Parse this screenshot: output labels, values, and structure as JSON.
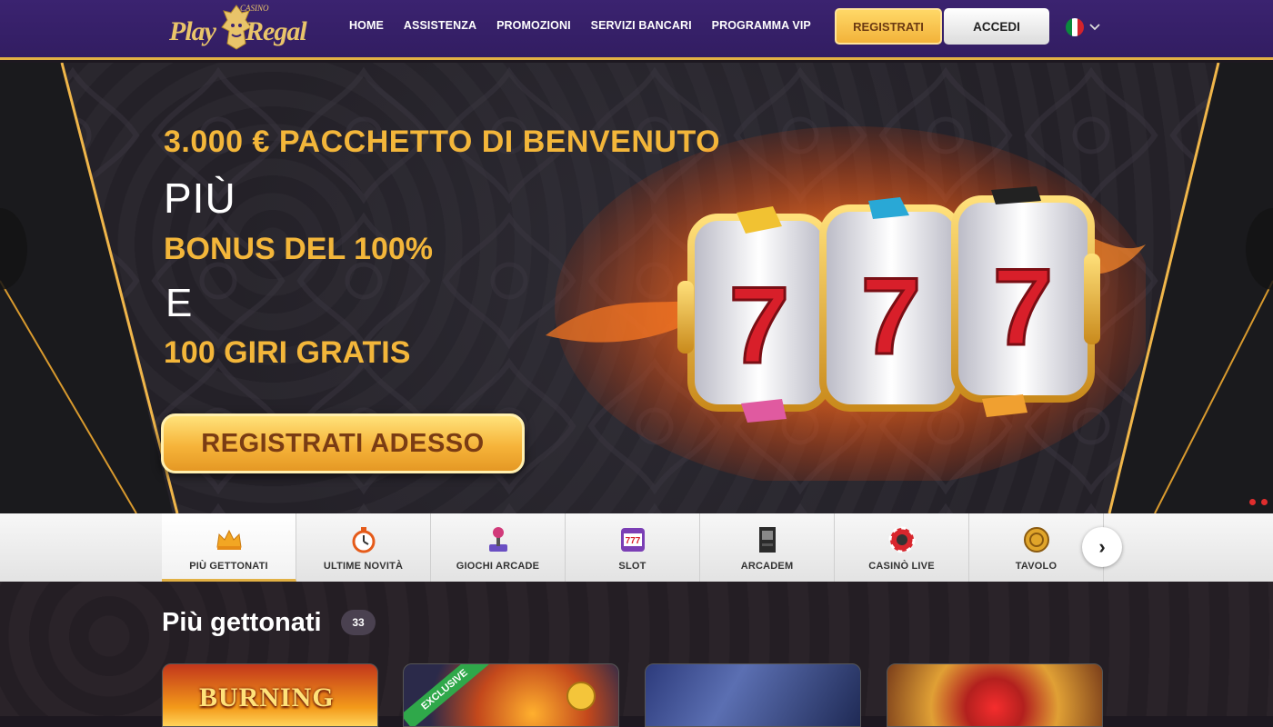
{
  "header": {
    "logo": {
      "casino": "CASINO",
      "play": "Play",
      "regal": "Regal"
    },
    "nav": [
      {
        "label": "HOME"
      },
      {
        "label": "ASSISTENZA"
      },
      {
        "label": "PROMOZIONI"
      },
      {
        "label": "SERVIZI BANCARI"
      },
      {
        "label": "PROGRAMMA VIP"
      }
    ],
    "register_label": "REGISTRATI",
    "login_label": "ACCEDI",
    "language_icon": "italy-flag-icon",
    "language_chevron": "chevron-down-icon"
  },
  "hero": {
    "line1": "3.000 € PACCHETTO DI BENVENUTO",
    "line2": "PIÙ",
    "line3": "BONUS DEL 100%",
    "line4": "E",
    "line5": "100 GIRI GRATIS",
    "cta_label": "REGISTRATI ADESSO",
    "colors": {
      "accent": "#f3b63a",
      "white": "#ffffff"
    }
  },
  "categories": [
    {
      "label": "PIÙ GETTONATI",
      "icon": "crown-icon",
      "active": true
    },
    {
      "label": "ULTIME NOVITÀ",
      "icon": "stopwatch-icon",
      "active": false
    },
    {
      "label": "GIOCHI ARCADE",
      "icon": "joystick-icon",
      "active": false
    },
    {
      "label": "SLOT",
      "icon": "slot-machine-icon",
      "active": false
    },
    {
      "label": "ARCADEM",
      "icon": "arcade-cabinet-icon",
      "active": false
    },
    {
      "label": "CASINÒ LIVE",
      "icon": "roulette-chip-icon",
      "active": false
    },
    {
      "label": "TAVOLO",
      "icon": "table-chip-icon",
      "active": false
    }
  ],
  "section": {
    "title": "Più gettonati",
    "count": "33"
  },
  "games": [
    {
      "title_visible": "BURNING"
    },
    {
      "ribbon": "EXCLUSIVE"
    },
    {},
    {}
  ]
}
